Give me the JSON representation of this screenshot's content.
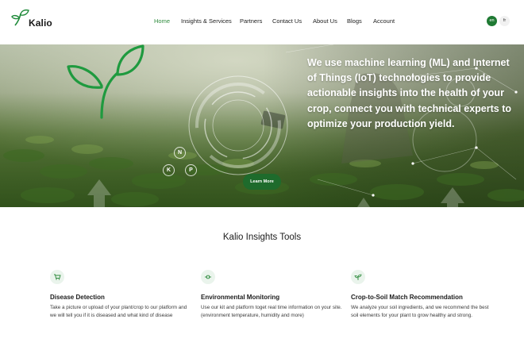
{
  "brand": {
    "name": "Kalio"
  },
  "nav": {
    "items": [
      {
        "label": "Home",
        "active": true
      },
      {
        "label": "Insights & Services",
        "active": false
      },
      {
        "label": "Partners",
        "active": false
      },
      {
        "label": "Contact Us",
        "active": false
      },
      {
        "label": "About Us",
        "active": false
      },
      {
        "label": "Blogs",
        "active": false
      },
      {
        "label": "Account",
        "active": false
      }
    ]
  },
  "languages": {
    "current": "en",
    "other": "fr"
  },
  "hero": {
    "headline": "We use machine learning (ML) and Internet of Things (IoT) technologies to provide actionable insights into the health of your crop, connect you with technical experts to optimize your production yield.",
    "button_label": "Learn More",
    "icon_labels": [
      "N",
      "K",
      "P"
    ]
  },
  "tools": {
    "title": "Kalio Insights Tools",
    "items": [
      {
        "icon": "cart-icon",
        "title": "Disease Detection",
        "description": "Take a picture or upload of your plant/crop to our platform and we will tell you if it is diseased and what kind of disease"
      },
      {
        "icon": "monitor-icon",
        "title": "Environmental Monitoring",
        "description": "Use our kit and platform toget real time information on your site. (environment temperature, humidity and more)"
      },
      {
        "icon": "sprout-icon",
        "title": "Crop-to-Soil Match Recommendation",
        "description": "We analyze your soil ingredients, and we recommend the best soil elements for your plant to grow healthy and strong."
      }
    ]
  },
  "colors": {
    "brand_green": "#1f7a33",
    "nav_active": "#2e8b3d",
    "button_green": "#1e6b2c",
    "icon_bg": "#eaf4ec"
  }
}
